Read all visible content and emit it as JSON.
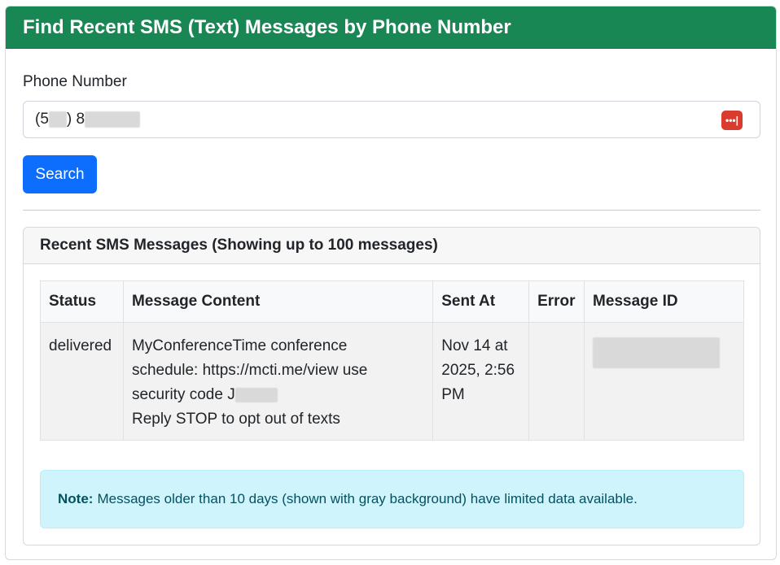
{
  "header": {
    "title": "Find Recent SMS (Text) Messages by Phone Number"
  },
  "form": {
    "phone_label": "Phone Number",
    "phone_value_prefix": "(5",
    "phone_value_mid": ") 8",
    "password_manager_icon": "ellipsis-icon",
    "search_label": "Search"
  },
  "results": {
    "title": "Recent SMS Messages (Showing up to 100 messages)",
    "columns": [
      "Status",
      "Message Content",
      "Sent At",
      "Error",
      "Message ID"
    ],
    "rows": [
      {
        "status": "delivered",
        "content_line1": "MyConferenceTime conference",
        "content_line2": "schedule: https://mcti.me/view use",
        "content_line3": "security code J",
        "content_line4": "Reply STOP to opt out of texts",
        "sent_line1": "Nov 14 at",
        "sent_line2": "2025, 2:56",
        "sent_line3": "PM",
        "error": ""
      }
    ]
  },
  "note": {
    "label": "Note:",
    "text": "Messages older than 10 days (shown with gray background) have limited data available."
  },
  "colors": {
    "header_bg": "#198754",
    "button_bg": "#0d6efd",
    "note_bg": "#cff4fc",
    "note_text": "#055160"
  }
}
